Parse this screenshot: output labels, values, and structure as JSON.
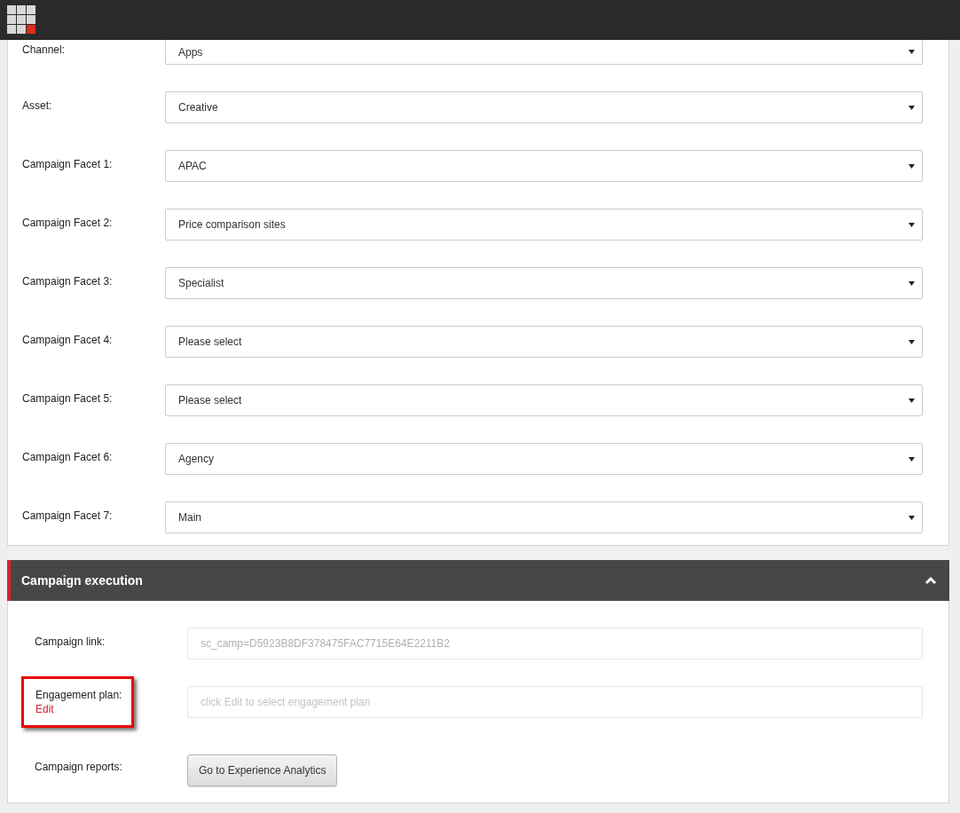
{
  "fields": [
    {
      "label": "Channel:",
      "value": "Apps"
    },
    {
      "label": "Asset:",
      "value": "Creative"
    },
    {
      "label": "Campaign Facet 1:",
      "value": "APAC"
    },
    {
      "label": "Campaign Facet 2:",
      "value": "Price comparison sites"
    },
    {
      "label": "Campaign Facet 3:",
      "value": "Specialist"
    },
    {
      "label": "Campaign Facet 4:",
      "value": "Please select"
    },
    {
      "label": "Campaign Facet 5:",
      "value": "Please select"
    },
    {
      "label": "Campaign Facet 6:",
      "value": "Agency"
    },
    {
      "label": "Campaign Facet 7:",
      "value": "Main"
    }
  ],
  "execution": {
    "title": "Campaign execution",
    "expanded": true,
    "campaign_link": {
      "label": "Campaign link:",
      "value": "sc_camp=D5923B8DF378475FAC7715E64E2211B2"
    },
    "engagement_plan": {
      "label": "Engagement plan:",
      "link": "Edit",
      "placeholder": "click Edit to select engagement plan",
      "highlighted": true
    },
    "campaign_reports": {
      "label": "Campaign reports:",
      "button": "Go to Experience Analytics"
    }
  }
}
